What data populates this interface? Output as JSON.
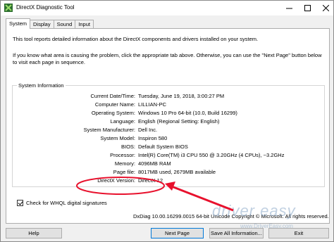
{
  "window": {
    "title": "DirectX Diagnostic Tool"
  },
  "tabs": [
    {
      "label": "System"
    },
    {
      "label": "Display"
    },
    {
      "label": "Sound"
    },
    {
      "label": "Input"
    }
  ],
  "intro": {
    "line1": "This tool reports detailed information about the DirectX components and drivers installed on your system.",
    "line2": "If you know what area is causing the problem, click the appropriate tab above.  Otherwise, you can use the \"Next Page\" button below to visit each page in sequence."
  },
  "system_info": {
    "group_label": "System Information",
    "rows": [
      {
        "label": "Current Date/Time:",
        "value": "Tuesday, June 19, 2018, 3:00:27 PM"
      },
      {
        "label": "Computer Name:",
        "value": "LILLIAN-PC"
      },
      {
        "label": "Operating System:",
        "value": "Windows 10 Pro 64-bit (10.0, Build 16299)"
      },
      {
        "label": "Language:",
        "value": "English (Regional Setting: English)"
      },
      {
        "label": "System Manufacturer:",
        "value": "Dell Inc."
      },
      {
        "label": "System Model:",
        "value": "Inspiron 580"
      },
      {
        "label": "BIOS:",
        "value": "Default System BIOS"
      },
      {
        "label": "Processor:",
        "value": "Intel(R) Core(TM) i3 CPU       550  @ 3.20GHz (4 CPUs), ~3.2GHz"
      },
      {
        "label": "Memory:",
        "value": "4096MB RAM"
      },
      {
        "label": "Page file:",
        "value": "8017MB used, 2679MB available"
      },
      {
        "label": "DirectX Version:",
        "value": "DirectX 12"
      }
    ]
  },
  "whql_checkbox": {
    "label": "Check for WHQL digital signatures",
    "checked": true
  },
  "footer_text": "DxDiag 10.00.16299.0015 64-bit Unicode  Copyright © Microsoft. All rights reserved.",
  "buttons": {
    "help": "Help",
    "next_page": "Next Page",
    "save_all": "Save All Information...",
    "exit": "Exit"
  },
  "watermark": {
    "brand": "driver easy",
    "url": "www.DriverEasy.com"
  },
  "annotation_color": "#e8112d"
}
